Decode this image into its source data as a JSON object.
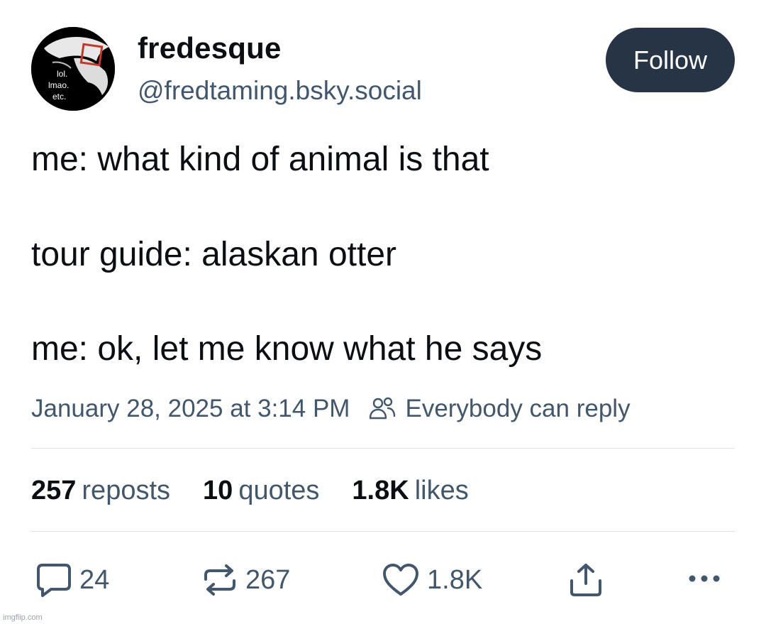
{
  "author": {
    "display_name": "fredesque",
    "handle": "@fredtaming.bsky.social",
    "avatar_text": [
      "lol.",
      "lmao.",
      "etc."
    ]
  },
  "follow_button": {
    "label": "Follow"
  },
  "post": {
    "lines": [
      "me: what kind of animal is that",
      "tour guide: alaskan otter",
      "me: ok, let me know what he says"
    ],
    "timestamp": "January 28, 2025 at 3:14 PM",
    "reply_setting": "Everybody can reply"
  },
  "stats": [
    {
      "count": "257",
      "label": "reposts"
    },
    {
      "count": "10",
      "label": "quotes"
    },
    {
      "count": "1.8K",
      "label": "likes"
    }
  ],
  "actions": {
    "reply_icon": "comment-icon",
    "reply_count": "24",
    "repost_icon": "repost-icon",
    "repost_count": "267",
    "like_icon": "heart-icon",
    "like_count": "1.8K",
    "share_icon": "share-icon",
    "more_icon": "ellipsis-icon"
  },
  "watermark": "imgflip.com",
  "colors": {
    "follow_button_bg": "#263445",
    "secondary_text": "#42576c",
    "primary_text": "#0b0f14",
    "divider": "#dfe3e8"
  }
}
